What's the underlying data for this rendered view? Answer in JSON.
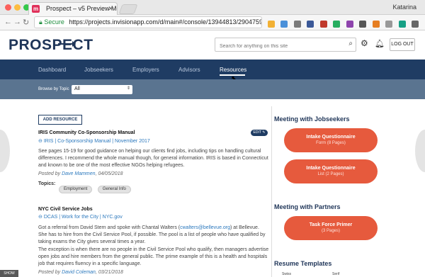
{
  "browser": {
    "tab_title": "Prospect – v5 Preview Mode",
    "profile": "Katarina",
    "secure_label": "Secure",
    "url": "https://projects.invisionapp.com/d/main#/console/13944813/290475954/pre..."
  },
  "header": {
    "logo": "PROSPECT",
    "search_placeholder": "Search for anything on this site",
    "logout_label": "LOG OUT"
  },
  "nav": {
    "items": [
      "Dashboard",
      "Jobseekers",
      "Employers",
      "Advisors",
      "Resources"
    ],
    "active": "Resources"
  },
  "filter": {
    "label": "Browse by Topic",
    "value": "All"
  },
  "main": {
    "add_resource_label": "ADD RESOURCE",
    "resources": [
      {
        "title": "IRIS Community Co-Sponsorship Manual",
        "link": "IRIS | Co-Sponsorship Manual | November 2017",
        "body": "See pages 15-19 for good guidance on helping our clients find jobs, including tips on handling cultural differences. I recommend the whole manual though, for general information. IRIS is based in Connecticut and known to be one of the most effective NGOs helping refugees.",
        "posted_by_prefix": "Posted by",
        "author": "Dave Mammen",
        "date": ", 04/05/2018",
        "topics_label": "Topics:",
        "topics": [
          "Employment",
          "General Info"
        ],
        "edit_label": "EDIT"
      },
      {
        "title": "NYC Civil Service Jobs",
        "link": "DCAS | Work for the City | NYC.gov",
        "body_p1_a": "Got a referral from David Stern and spoke with Chantal Walters (",
        "body_p1_email": "cwalters@bellevue.org",
        "body_p1_b": ") at Bellevue. She has to hire from the Civil Service Pool, if possible. The pool is a list of people who have qualified by taking exams the City gives several times a year.",
        "body_p2": "The exception is when there are no people in the Civil Service Pool who qualify, then managers advertise open jobs and hire members from the general public. The prime example of this is a health and hospitals job that requires fluency in a specific language.",
        "posted_by_prefix": "Posted by",
        "author": "David Coleman",
        "date": ", 03/21/2018"
      }
    ]
  },
  "sidebar": {
    "jobseekers_heading": "Meeting with Jobseekers",
    "jobseekers_buttons": [
      {
        "title": "Intake Questionnaire",
        "sub": "Form (8 Pages)"
      },
      {
        "title": "Intake Questionnaire",
        "sub": "List (2 Pages)"
      }
    ],
    "partners_heading": "Meeting with Partners",
    "partners_buttons": [
      {
        "title": "Task Force Primer",
        "sub": "(3 Pages)"
      }
    ],
    "templates_heading": "Resume Templates",
    "template_cols": [
      "Swiss",
      "Serif"
    ]
  },
  "footer": {
    "show_label": "SHOW"
  },
  "colors": {
    "navy": "#1f3c63",
    "accent": "#e65a3d",
    "link": "#2b78bd"
  }
}
